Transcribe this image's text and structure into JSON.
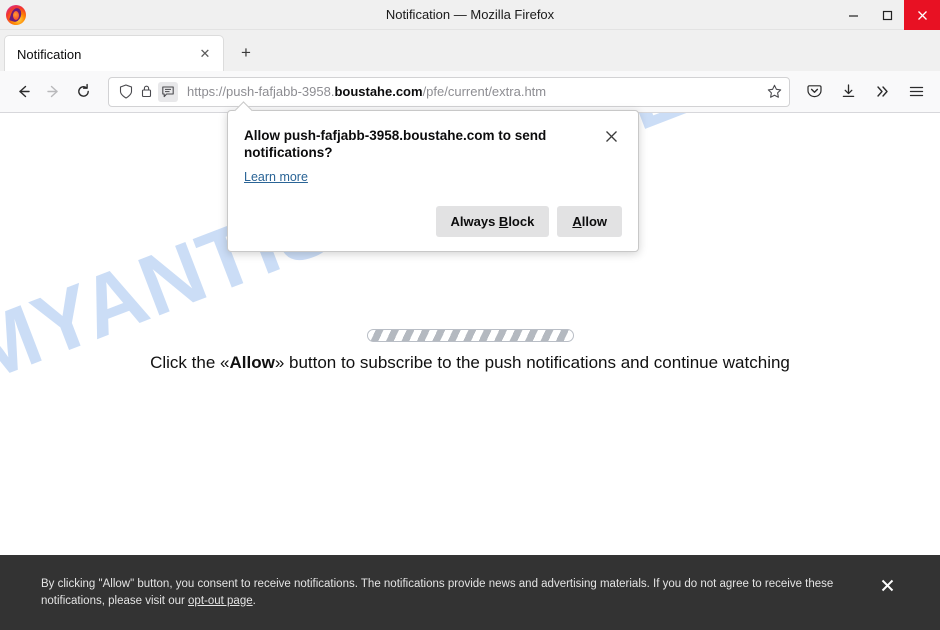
{
  "window": {
    "title": "Notification — Mozilla Firefox",
    "minimize_label": "—",
    "maximize_label": "☐",
    "close_label": "✕"
  },
  "tabs": {
    "items": [
      {
        "label": "Notification",
        "close_label": "✕"
      }
    ],
    "new_tab_label": "+"
  },
  "toolbar": {
    "back_title": "Back",
    "forward_title": "Forward",
    "reload_title": "Reload",
    "url_prefix": "https://push-fafjabb-3958.",
    "url_domain": "boustahe.com",
    "url_suffix": "/pfe/current/extra.htm",
    "url_full": "https://push-fafjabb-3958.boustahe.com/pfe/current/extra.htm",
    "shield_title": "Tracking protection",
    "lock_title": "Connection secure",
    "permission_title": "Site permissions",
    "bookmark_title": "Bookmark this page",
    "pocket_title": "Save to Pocket",
    "downloads_title": "Downloads",
    "overflow_label": "»",
    "menu_title": "Open application menu"
  },
  "popup": {
    "title": "Allow push-fafjabb-3958.boustahe.com to send notifications?",
    "close_label": "✕",
    "learn_more": "Learn more",
    "always_block_pre": "Always ",
    "always_block_key": "B",
    "always_block_post": "lock",
    "allow_key": "A",
    "allow_post": "llow"
  },
  "page": {
    "watermark": "MYANTISPYWARE.COM",
    "cta_pre": "Click the «",
    "cta_bold": "Allow",
    "cta_post": "» button to subscribe to the push notifications and continue watching",
    "loader_label": "loading"
  },
  "consent": {
    "line1": "By clicking \"Allow\" button, you consent to receive notifications. The notifications provide news and advertising materials. If you do not agree to receive these",
    "line2_pre": "notifications, please visit our ",
    "link": "opt-out page",
    "line2_post": ".",
    "close_label": "✕"
  },
  "colors": {
    "accent_close": "#e81123",
    "consent_bg": "#333333",
    "watermark": "#c9dcf6",
    "link": "#2a6496"
  }
}
